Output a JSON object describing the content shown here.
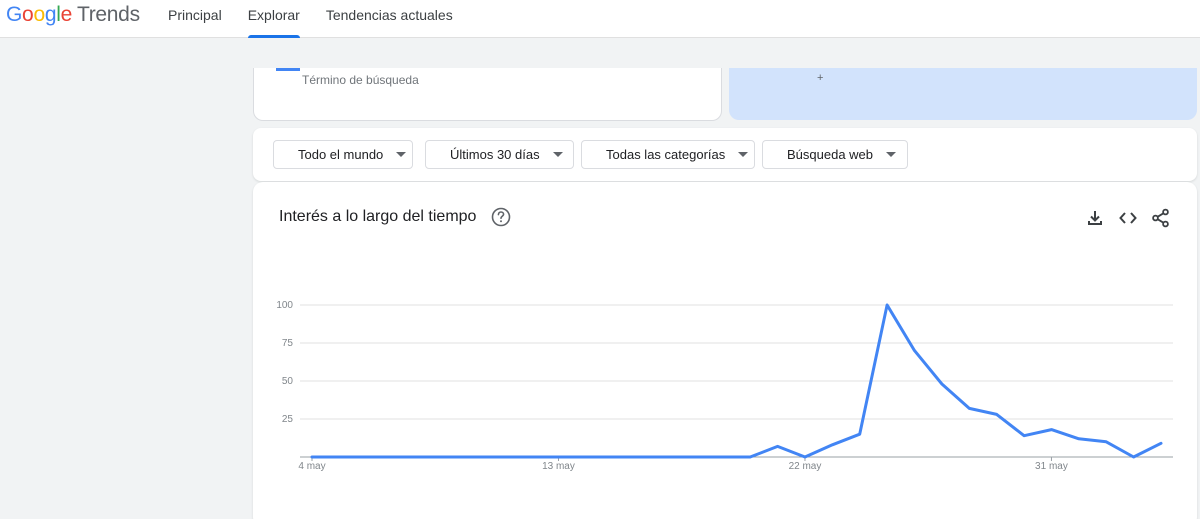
{
  "header": {
    "logo_google": [
      "G",
      "o",
      "o",
      "g",
      "l",
      "e"
    ],
    "logo_trends": "Trends",
    "tabs": [
      {
        "label": "Principal",
        "active": false
      },
      {
        "label": "Explorar",
        "active": true
      },
      {
        "label": "Tendencias actuales",
        "active": false
      }
    ]
  },
  "search": {
    "term_label": "Término de búsqueda",
    "compare_hint": "+"
  },
  "filters": [
    {
      "label": "Todo el mundo"
    },
    {
      "label": "Últimos 30 días"
    },
    {
      "label": "Todas las categorías"
    },
    {
      "label": "Búsqueda web"
    }
  ],
  "chart_card": {
    "title": "Interés a lo largo del tiempo",
    "actions": [
      "download-icon",
      "embed-code-icon",
      "share-icon"
    ]
  },
  "colors": {
    "accent": "#1a73e8",
    "series": "#4285f4",
    "compare_bg": "#d2e3fc",
    "page_bg": "#f1f3f4"
  },
  "chart_data": {
    "type": "line",
    "title": "",
    "xlabel": "",
    "ylabel": "",
    "ylim": [
      0,
      100
    ],
    "yticks": [
      25,
      50,
      75,
      100
    ],
    "x": [
      "4 may",
      "5 may",
      "6 may",
      "7 may",
      "8 may",
      "9 may",
      "10 may",
      "11 may",
      "12 may",
      "13 may",
      "14 may",
      "15 may",
      "16 may",
      "17 may",
      "18 may",
      "19 may",
      "20 may",
      "21 may",
      "22 may",
      "23 may",
      "24 may",
      "25 may",
      "26 may",
      "27 may",
      "28 may",
      "29 may",
      "30 may",
      "31 may",
      "1 jun",
      "2 jun",
      "3 jun",
      "4 jun"
    ],
    "xtick_labels": [
      "4 may",
      "13 may",
      "22 may",
      "31 may"
    ],
    "xtick_indices": [
      0,
      9,
      18,
      27
    ],
    "series": [
      {
        "values": [
          0,
          0,
          0,
          0,
          0,
          0,
          0,
          0,
          0,
          0,
          0,
          0,
          0,
          0,
          0,
          0,
          0,
          7,
          0,
          8,
          15,
          100,
          70,
          48,
          32,
          28,
          14,
          18,
          12,
          10,
          0,
          9
        ]
      }
    ],
    "grid": true
  }
}
